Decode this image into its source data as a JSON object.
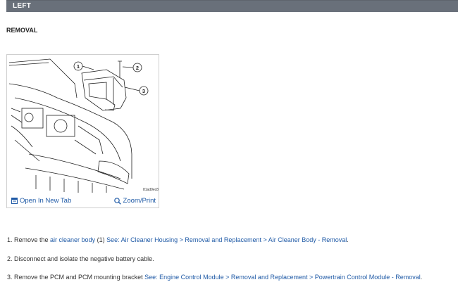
{
  "header": {
    "title": "LEFT"
  },
  "section": {
    "title": "REMOVAL"
  },
  "figure": {
    "callouts": [
      "1",
      "2",
      "3"
    ],
    "image_code": "81ad9ec8",
    "open_label": "Open In New Tab",
    "zoom_label": "Zoom/Print"
  },
  "steps": [
    {
      "prefix": "1. Remove the ",
      "link1": "air cleaner body",
      "mid": " (1) ",
      "link2": "See: Air Cleaner Housing > Removal and Replacement > Air Cleaner Body - Removal",
      "suffix": "."
    },
    {
      "text": "2. Disconnect and isolate the negative battery cable."
    },
    {
      "prefix": "3. Remove the PCM and PCM mounting bracket ",
      "link": "See: Engine Control Module > Removal and Replacement > Powertrain Control Module - Removal",
      "suffix": "."
    }
  ],
  "colors": {
    "header_bg": "#69707a",
    "link": "#1f5aa6"
  }
}
